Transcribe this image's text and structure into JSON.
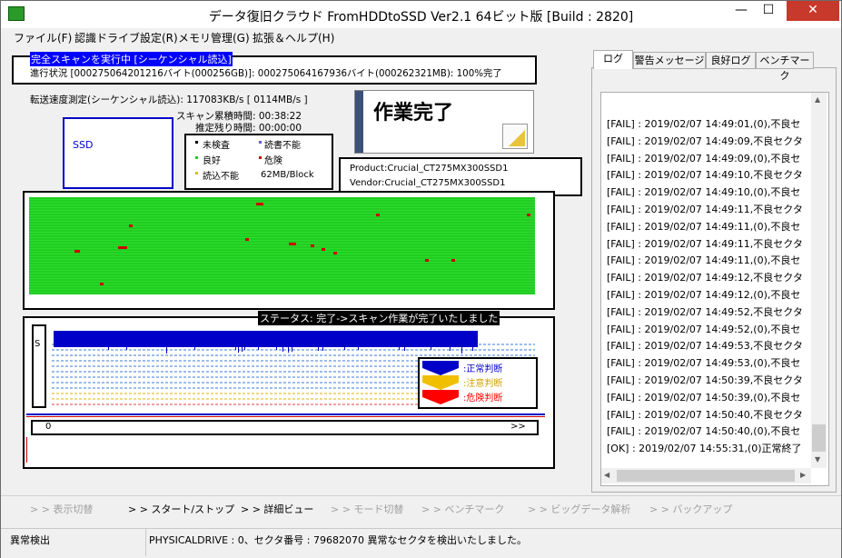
{
  "window": {
    "title": "データ復旧クラウド FromHDDtoSSD Ver2.1 64ビット版 [Build : 2820]",
    "minimize_glyph": "—",
    "maximize_glyph": "☐",
    "close_glyph": "✕"
  },
  "menu": [
    "ファイル(F)",
    "認識ドライブ設定(R)",
    "メモリ管理(G)",
    "拡張＆ヘルプ(H)"
  ],
  "scan": {
    "mode": "完全スキャンを実行中 [シーケンシャル読込]",
    "progress": "進行状況 [000275064201216バイト(000256GB)]: 000275064167936バイト(000262321MB): 100%完了",
    "speed": "転送速度測定(シーケンシャル読込): 117083KB/s [ 0114MB/s ]",
    "elapsed": "スキャン累積時間: 00:38:22",
    "remaining": "推定残り時間: 00:00:00",
    "drive_label": "SSD",
    "completion": "作業完了"
  },
  "legend": {
    "unchecked": "未検査",
    "write_disabled": "読書不能",
    "good": "良好",
    "danger": "危険",
    "read_disabled": "読込不能",
    "block_size": "62MB/Block"
  },
  "device": {
    "product": "Product:Crucial_CT275MX300SSD1",
    "vendor": "Vendor:Crucial_CT275MX300SSD1"
  },
  "status_text": "ステータス: 完了->スキャン作業が完了いたしました",
  "graph": {
    "s_label": "S",
    "legend_normal": ":正常判断",
    "legend_warning": ":注意判断",
    "legend_danger": ":危険判断",
    "scroll_start": "0",
    "scroll_end": ">>"
  },
  "tabs": [
    "ログ",
    "警告メッセージ",
    "良好ログ",
    "ベンチマーク"
  ],
  "log_lines": [
    "[FAIL] : 2019/02/07 14:49:01,(0),不良セ",
    "[FAIL] : 2019/02/07 14:49:09,不良セクタ",
    "[FAIL] : 2019/02/07 14:49:09,(0),不良セ",
    "[FAIL] : 2019/02/07 14:49:10,不良セクタ",
    "[FAIL] : 2019/02/07 14:49:10,(0),不良セ",
    "[FAIL] : 2019/02/07 14:49:11,不良セクタ",
    "[FAIL] : 2019/02/07 14:49:11,(0),不良セ",
    "[FAIL] : 2019/02/07 14:49:11,不良セクタ",
    "[FAIL] : 2019/02/07 14:49:11,(0),不良セ",
    "[FAIL] : 2019/02/07 14:49:12,不良セクタ",
    "[FAIL] : 2019/02/07 14:49:12,(0),不良セ",
    "[FAIL] : 2019/02/07 14:49:52,不良セクタ",
    "[FAIL] : 2019/02/07 14:49:52,(0),不良セ",
    "[FAIL] : 2019/02/07 14:49:53,不良セクタ",
    "[FAIL] : 2019/02/07 14:49:53,(0),不良セ",
    "[FAIL] : 2019/02/07 14:50:39,不良セクタ",
    "[FAIL] : 2019/02/07 14:50:39,(0),不良セ",
    "[FAIL] : 2019/02/07 14:50:40,不良セクタ",
    "[FAIL] : 2019/02/07 14:50:40,(0),不良セ",
    "[OK] : 2019/02/07 14:55:31,(0)正常終了"
  ],
  "toolbar": [
    "> > 表示切替",
    "> > スタート/ストップ",
    "> > 詳細ビュー",
    "> > モード切替",
    "> > ベンチマーク",
    "> > ビッグデータ解析",
    "> > バックアップ"
  ],
  "statusbar": {
    "left": "異常検出",
    "right": "PHYSICALDRIVE : 0、セクタ番号 : 79682070 異常なセクタを検出いたしました。"
  },
  "colors": {
    "good": "#22cc22",
    "bad": "#cc0000",
    "bar": "#0000c8",
    "selection": "#0000ff"
  }
}
